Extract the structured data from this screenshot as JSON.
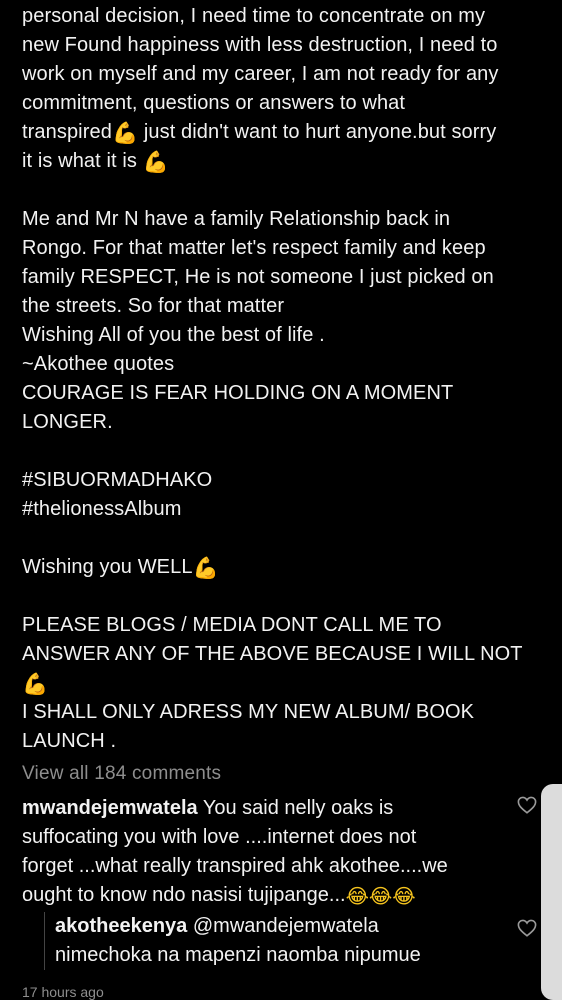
{
  "caption": {
    "lines": [
      "personal decision,  I need time to concentrate on my",
      "new Found happiness with less destruction,  I need to",
      "work on myself and my career, I am not ready for any",
      "commitment, questions or answers to what",
      "transpired",
      " just didn't want to hurt anyone.but sorry",
      "it is what it is ",
      "Me and Mr  N have a family Relationship back in",
      "Rongo. For  that matter let's respect family and keep",
      "family RESPECT, He is not someone I just picked on",
      "the streets.  So for that matter",
      "Wishing All of you the best of life .",
      "~Akothee quotes",
      "COURAGE IS FEAR HOLDING ON A MOMENT",
      "LONGER.",
      "#SIBUORMADHAKO",
      "#thelionessAlbum",
      "Wishing you WELL",
      "PLEASE BLOGS / MEDIA DONT CALL ME TO",
      "ANSWER ANY OF THE ABOVE BECAUSE I WILL NOT",
      "I SHALL ONLY ADRESS MY NEW ALBUM/ BOOK",
      "LAUNCH ."
    ],
    "flex_emoji": "💪"
  },
  "view_all_comments": "View all 184 comments",
  "comments": [
    {
      "username": "mwandejemwatela",
      "lines": [
        " You said nelly oaks is",
        "suffocating you with love ....internet does not",
        "forget ...what really transpired ahk akothee....we",
        "ought to know ndo nasisi tujipange..."
      ],
      "laugh_emoji": "😂😂😂"
    }
  ],
  "reply": {
    "username": "akotheekenya",
    "mention": " @mwandejemwatela",
    "text": "nimechoka na mapenzi naomba nipumue"
  },
  "timestamp": "17 hours ago",
  "icons": {
    "heart": "heart-outline-icon",
    "emoji_flex": "flexed-biceps-emoji",
    "emoji_laugh": "tears-of-joy-emoji"
  },
  "colors": {
    "background": "#000000",
    "text": "#f2f2f2",
    "muted": "#8e8e8e",
    "scroll_handle": "#dcdcdc"
  }
}
